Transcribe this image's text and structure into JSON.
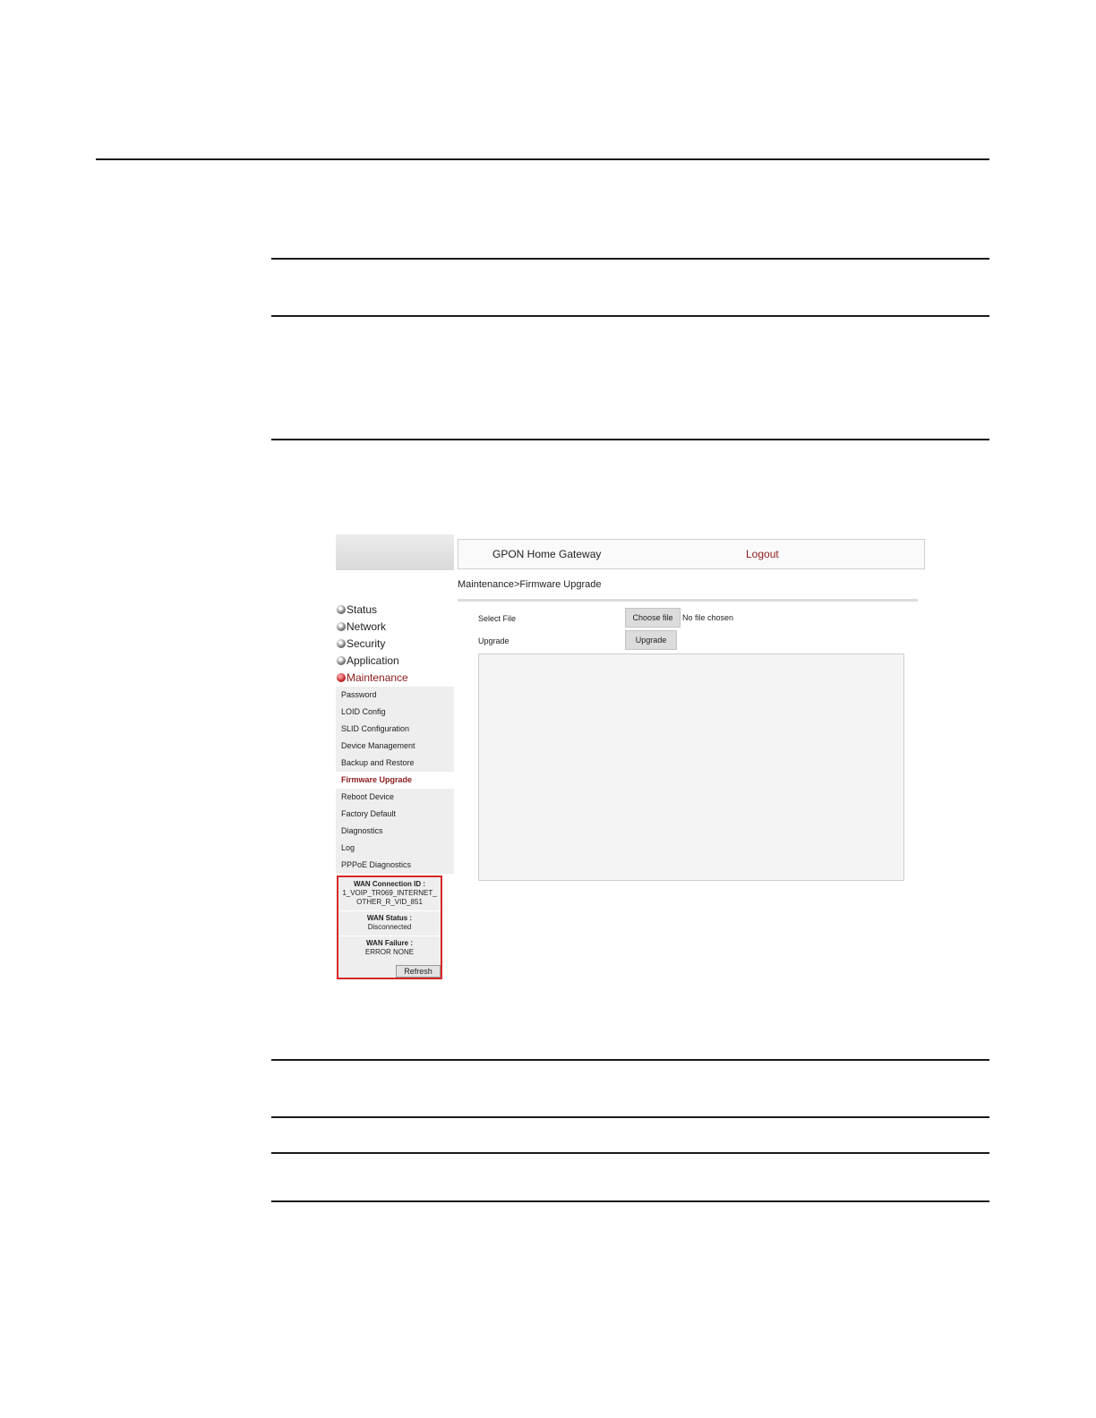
{
  "header": {
    "title": "GPON Home Gateway",
    "logout_label": "Logout"
  },
  "breadcrumb": "Maintenance>Firmware Upgrade",
  "nav": {
    "main": [
      {
        "label": "Status"
      },
      {
        "label": "Network"
      },
      {
        "label": "Security"
      },
      {
        "label": "Application"
      },
      {
        "label": "Maintenance",
        "active": true
      }
    ],
    "submenu": [
      "Password",
      "LOID Config",
      "SLID Configuration",
      "Device Management",
      "Backup and Restore",
      "Firmware Upgrade",
      "Reboot Device",
      "Factory Default",
      "Diagnostics",
      "Log",
      "PPPoE Diagnostics"
    ],
    "current_submenu": "Firmware Upgrade"
  },
  "wan": {
    "connection_label": "WAN Connection ID :",
    "connection_value": "1_VOIP_TR069_INTERNET_OTHER_R_VID_851",
    "status_label": "WAN Status :",
    "status_value": "Disconnected",
    "failure_label": "WAN Failure :",
    "failure_value": "ERROR NONE",
    "refresh_label": "Refresh"
  },
  "form": {
    "select_file_label": "Select File",
    "choose_file_label": "Choose file",
    "no_file_text": "No file chosen",
    "upgrade_label": "Upgrade",
    "upgrade_button_label": "Upgrade"
  },
  "colors": {
    "accent": "#8b1a1a",
    "highlight_border": "#d62828",
    "panel": "#eeeeee"
  }
}
